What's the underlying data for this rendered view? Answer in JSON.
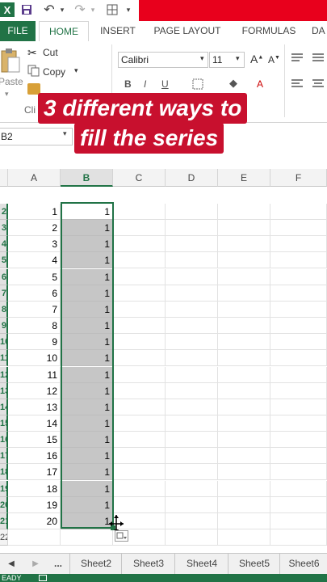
{
  "quick_access": {
    "icons": [
      "excel-logo-icon",
      "save-icon",
      "undo-icon",
      "undo-dropdown-icon",
      "redo-icon",
      "redo-dropdown-icon",
      "borders-icon",
      "customize-dropdown-icon"
    ]
  },
  "ribbon_tabs": [
    "FILE",
    "HOME",
    "INSERT",
    "PAGE LAYOUT",
    "FORMULAS",
    "DA"
  ],
  "ribbon": {
    "cut_label": "Cut",
    "copy_label": "Copy",
    "paste_label": "Paste",
    "clipboard_group": "Cli",
    "font_name": "Calibri",
    "font_size": "11",
    "bold": "B",
    "italic": "I",
    "underline": "U",
    "grow_font": "A",
    "shrink_font": "A",
    "font_color_glyph": "A"
  },
  "name_box": {
    "value": "B2"
  },
  "overlay_title": {
    "line1": "3 different ways to",
    "line2": "fill the series"
  },
  "grid": {
    "columns": [
      "A",
      "B",
      "C",
      "D",
      "E",
      "F"
    ],
    "row_numbers": [
      "2",
      "3",
      "4",
      "5",
      "6",
      "7",
      "8",
      "9",
      "10",
      "11",
      "12",
      "13",
      "14",
      "15",
      "16",
      "17",
      "18",
      "19",
      "20",
      "21",
      "22"
    ],
    "column_a": [
      "1",
      "2",
      "3",
      "4",
      "5",
      "6",
      "7",
      "8",
      "9",
      "10",
      "11",
      "12",
      "13",
      "14",
      "15",
      "16",
      "17",
      "18",
      "19",
      "20"
    ],
    "column_b": [
      "1",
      "1",
      "1",
      "1",
      "1",
      "1",
      "1",
      "1",
      "1",
      "1",
      "1",
      "1",
      "1",
      "1",
      "1",
      "1",
      "1",
      "1",
      "1",
      "1"
    ]
  },
  "sheet_tabs": [
    "...",
    "Sheet2",
    "Sheet3",
    "Sheet4",
    "Sheet5",
    "Sheet6"
  ],
  "status": {
    "text": "EADY"
  },
  "colors": {
    "excel_green": "#217346",
    "title_red": "#c8102e",
    "top_banner_red": "#e8001c"
  }
}
